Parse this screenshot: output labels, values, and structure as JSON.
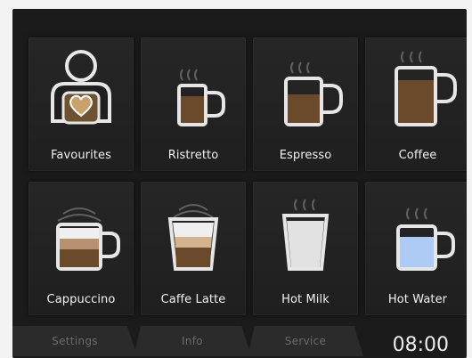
{
  "tiles": [
    {
      "label": "Favourites",
      "icon": "favourites-person-heart-icon"
    },
    {
      "label": "Ristretto",
      "icon": "ristretto-cup-icon"
    },
    {
      "label": "Espresso",
      "icon": "espresso-cup-icon"
    },
    {
      "label": "Coffee",
      "icon": "coffee-cup-icon"
    },
    {
      "label": "Cappuccino",
      "icon": "cappuccino-cup-icon"
    },
    {
      "label": "Caffe Latte",
      "icon": "caffe-latte-glass-icon"
    },
    {
      "label": "Hot Milk",
      "icon": "hot-milk-glass-icon"
    },
    {
      "label": "Hot Water",
      "icon": "hot-water-cup-icon"
    }
  ],
  "bottom_bar": {
    "settings": "Settings",
    "info": "Info",
    "service": "Service",
    "time": "08:00"
  },
  "colors": {
    "screen": "#1b1b1b",
    "tile": "#242424",
    "label": "#f2f2f2",
    "coffee": "#6b4a2b",
    "milk": "#e8e8e8",
    "water": "#aecbf6"
  }
}
